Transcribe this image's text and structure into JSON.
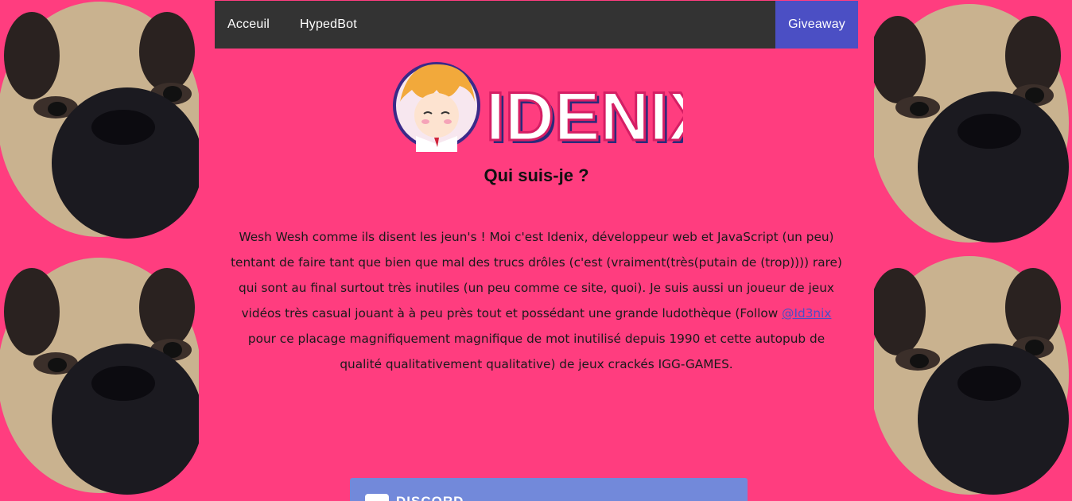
{
  "nav": {
    "home_label": "Acceuil",
    "bot_label": "HypedBot",
    "giveaway_label": "Giveaway"
  },
  "logo": {
    "text": "IDENIX"
  },
  "main": {
    "title": "Qui suis-je ?",
    "intro_before": "Wesh Wesh comme ils disent les jeun's ! Moi c'est Idenix, développeur web et JavaScript (un peu) tentant de faire tant que bien que mal des trucs drôles (c'est (vraiment(très(putain de (trop)))) rare) qui sont au final surtout très inutiles (un peu comme ce site, quoi). Je suis aussi un joueur de jeux vidéos très casual jouant à à peu près tout et possédant une grande ludothèque (Follow ",
    "intro_link": "@Id3nix",
    "intro_after": " pour ce placage magnifiquement magnifique de mot inutilisé depuis 1990 et cette autopub de qualité qualitativement qualitative) de jeux crackés IGG-GAMES."
  },
  "discord": {
    "label": "DISCORD"
  },
  "colors": {
    "background": "#ff3d7f",
    "nav": "#333333",
    "accent": "#4b4fc4",
    "discord": "#7289da"
  }
}
